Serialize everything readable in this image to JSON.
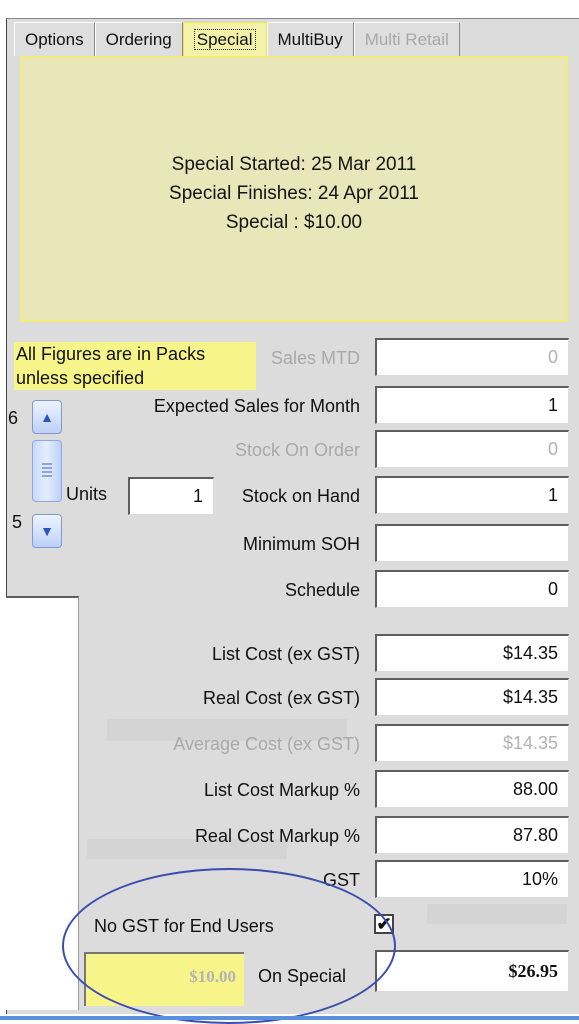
{
  "tabs": [
    {
      "label": "Options",
      "active": false,
      "disabled": false
    },
    {
      "label": "Ordering",
      "active": false,
      "disabled": false
    },
    {
      "label": "Special",
      "active": true,
      "disabled": false
    },
    {
      "label": "MultiBuy",
      "active": false,
      "disabled": false
    },
    {
      "label": "Multi Retail",
      "active": false,
      "disabled": true
    }
  ],
  "special": {
    "started": "Special Started: 25 Mar 2011",
    "finishes": "Special Finishes: 24 Apr 2011",
    "price": "Special : $10.00"
  },
  "note": "All Figures are in Packs unless specified",
  "units": {
    "label": "Units",
    "value": "1"
  },
  "scroll_edge_labels": {
    "top": "6",
    "bottom": "5"
  },
  "fields": {
    "sales_mtd": {
      "label": "Sales MTD",
      "value": "0"
    },
    "expected_sales": {
      "label": "Expected Sales for Month",
      "value": "1"
    },
    "stock_on_order": {
      "label": "Stock On Order",
      "value": "0"
    },
    "stock_on_hand": {
      "label": "Stock on Hand",
      "value": "1"
    },
    "minimum_soh": {
      "label": "Minimum SOH",
      "value": ""
    },
    "schedule": {
      "label": "Schedule",
      "value": "0"
    },
    "list_cost": {
      "label": "List Cost (ex GST)",
      "value": "$14.35"
    },
    "real_cost": {
      "label": "Real Cost (ex GST)",
      "value": "$14.35"
    },
    "average_cost": {
      "label": "Average Cost (ex GST)",
      "value": "$14.35"
    },
    "list_markup": {
      "label": "List Cost Markup %",
      "value": "88.00"
    },
    "real_markup": {
      "label": "Real Cost Markup %",
      "value": "87.80"
    },
    "gst": {
      "label": "GST",
      "value": "10%"
    }
  },
  "no_gst": {
    "label": "No GST for End Users",
    "checked": true,
    "check_mark": "✔"
  },
  "on_special": {
    "label": "On Special",
    "special_price": "$10.00",
    "value": "$26.95"
  }
}
